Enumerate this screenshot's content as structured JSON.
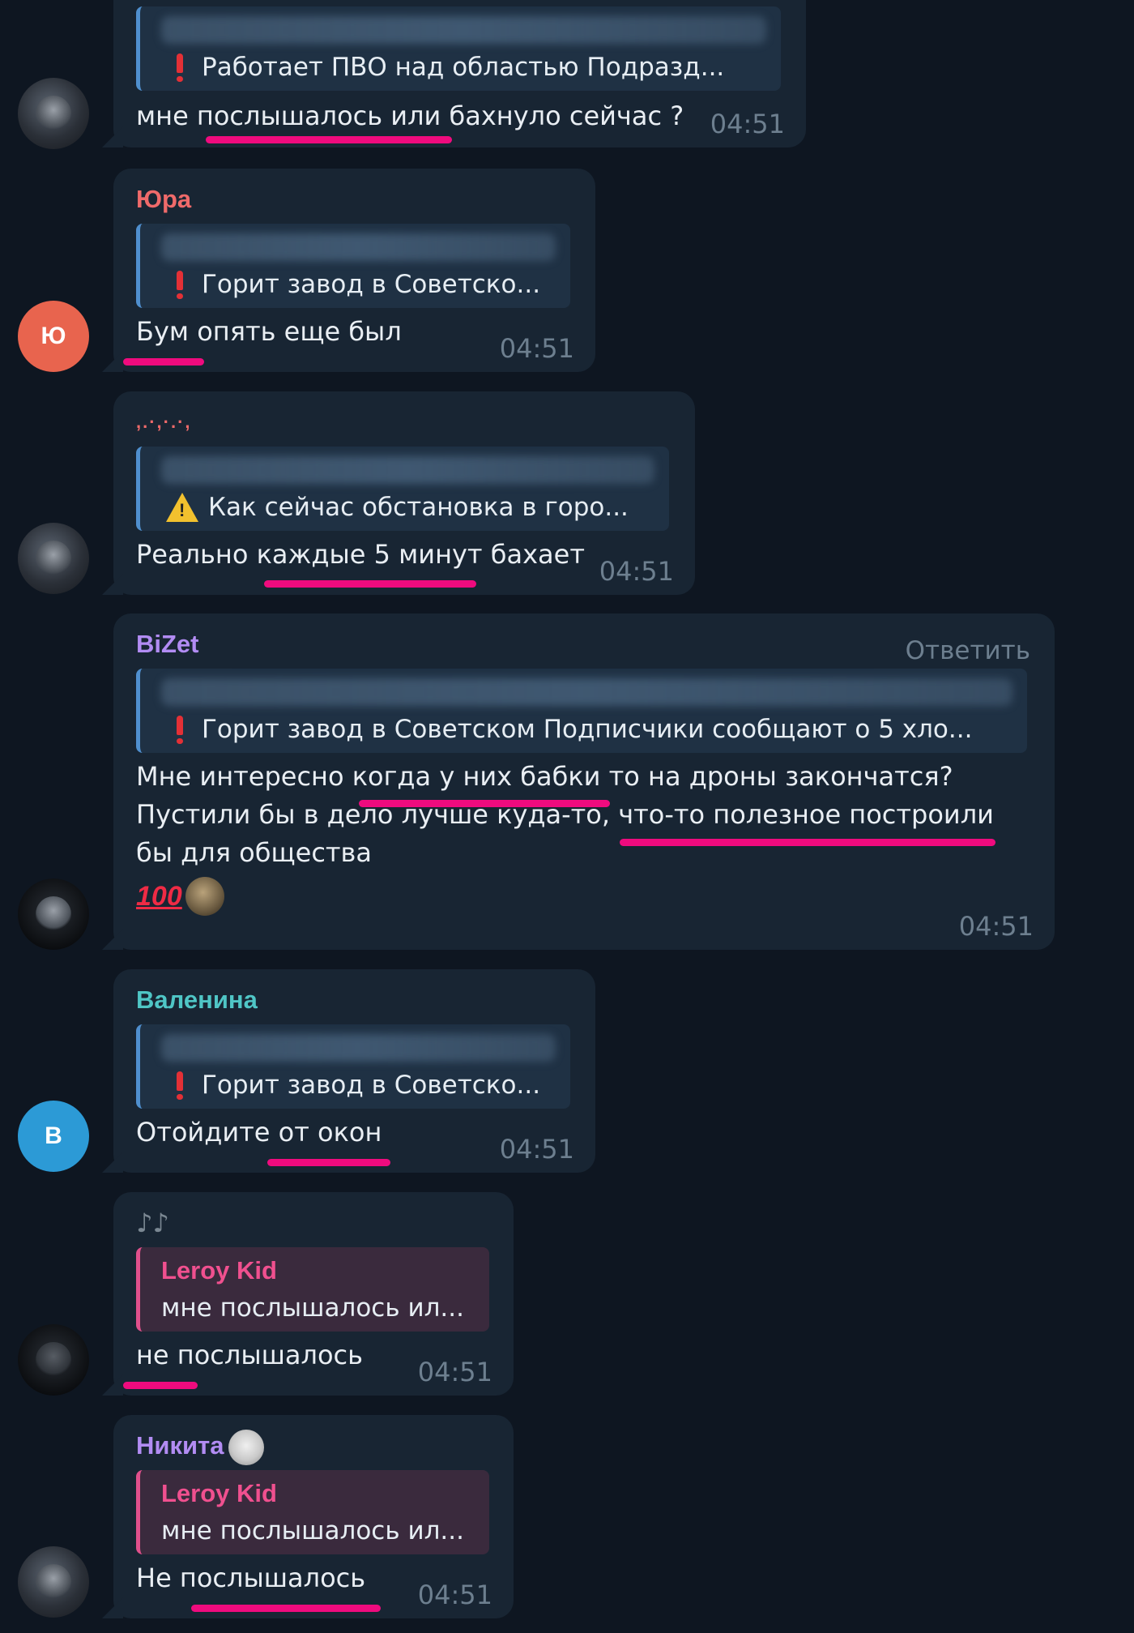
{
  "messages": [
    {
      "id": "m1",
      "sender": "",
      "avatar": {
        "type": "photo",
        "letter": "",
        "color": ""
      },
      "quote": {
        "kind": "channel",
        "icon": "exclamation-icon",
        "text": "Работает ПВО над областью  Подразд..."
      },
      "text": "мне послышалось или бахнуло сейчас ?",
      "time": "04:51"
    },
    {
      "id": "m2",
      "sender": "Юра",
      "sender_color": "#ef6a6a",
      "avatar": {
        "type": "letter",
        "letter": "Ю",
        "color": "#e8644e"
      },
      "quote": {
        "kind": "channel",
        "icon": "exclamation-icon",
        "text": "Горит завод в Советско..."
      },
      "text": "Бум опять еще был",
      "time": "04:51"
    },
    {
      "id": "m3",
      "sender": ",.·,·.·,",
      "sender_color": "#ef6a6a",
      "avatar": {
        "type": "photo",
        "letter": "",
        "color": ""
      },
      "quote": {
        "kind": "channel",
        "icon": "warning-icon",
        "text": "Как сейчас обстановка в горо..."
      },
      "text": "Реально каждые 5 минут бахает",
      "time": "04:51"
    },
    {
      "id": "m4",
      "sender": "BiZet",
      "sender_color": "#b28cf3",
      "reply_label": "Ответить",
      "avatar": {
        "type": "photo",
        "letter": "",
        "color": ""
      },
      "quote": {
        "kind": "channel",
        "icon": "exclamation-icon",
        "text": "Горит завод в Советском  Подписчики сообщают о 5 хло..."
      },
      "text_lines": [
        "Мне интересно когда у них бабки то на дроны закончатся?",
        "Пустили бы в дело лучше куда-то, что-то полезное построили",
        "бы для общества"
      ],
      "reaction_emoji": "100",
      "time": "04:51"
    },
    {
      "id": "m5",
      "sender": "Валенина",
      "sender_color": "#4fc6c6",
      "avatar": {
        "type": "letter",
        "letter": "В",
        "color": "#2c9ad6"
      },
      "quote": {
        "kind": "channel",
        "icon": "exclamation-icon",
        "text": "Горит завод в Советско..."
      },
      "text": "Отойдите от окон",
      "time": "04:51"
    },
    {
      "id": "m6",
      "sender": "♪♪",
      "avatar": {
        "type": "dark",
        "letter": "",
        "color": ""
      },
      "quote": {
        "kind": "reply",
        "name": "Leroy Kid",
        "text": "мне послышалось ил..."
      },
      "text": "не послышалось",
      "time": "04:51"
    },
    {
      "id": "m7",
      "sender": "Никита",
      "sender_color": "#b28cf3",
      "avatar": {
        "type": "photo",
        "letter": "",
        "color": ""
      },
      "quote": {
        "kind": "reply",
        "name": "Leroy Kid",
        "text": "мне послышалось ил..."
      },
      "text": "Не послышалось",
      "time": "04:51"
    }
  ],
  "colors": {
    "background": "#0e1621",
    "bubble": "#182533",
    "underline": "#ef0b7e",
    "timestamp": "#6d7f8f"
  }
}
